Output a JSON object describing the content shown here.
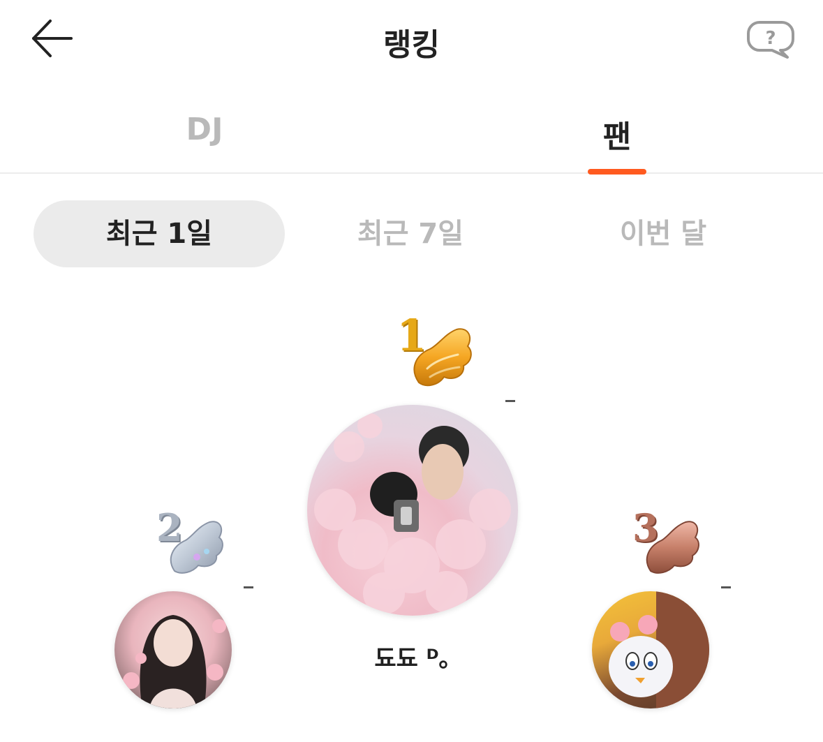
{
  "header": {
    "title": "랭킹",
    "back_icon": "arrow-left-icon",
    "help_icon": "question-bubble-icon"
  },
  "tabs": [
    {
      "label": "DJ",
      "active": false
    },
    {
      "label": "팬",
      "active": true
    }
  ],
  "accent_color": "#ff5a1f",
  "periods": [
    {
      "label": "최근 1일",
      "selected": true
    },
    {
      "label": "최근 7일",
      "selected": false
    },
    {
      "label": "이번 달",
      "selected": false
    }
  ],
  "podium": [
    {
      "rank": "1",
      "badge_icon": "gold-wing-badge-icon",
      "name": "됴됴 ᴰ｡",
      "change": "-"
    },
    {
      "rank": "2",
      "badge_icon": "silver-wing-badge-icon",
      "name": "",
      "change": "-"
    },
    {
      "rank": "3",
      "badge_icon": "bronze-wing-badge-icon",
      "name": "",
      "change": "-"
    }
  ]
}
